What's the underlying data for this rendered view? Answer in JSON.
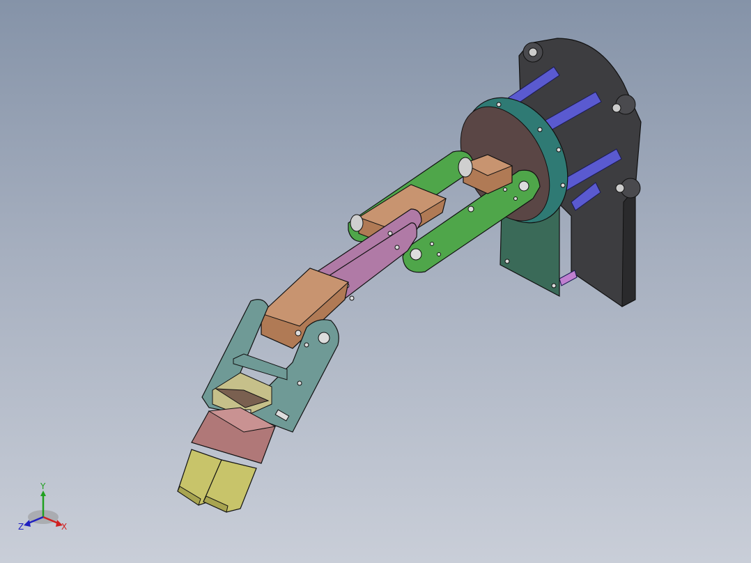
{
  "viewport": {
    "background_top": "#8593a8",
    "background_bottom": "#c9ced8"
  },
  "model": {
    "parts": [
      {
        "name": "base-plate",
        "color": "#3d3d40"
      },
      {
        "name": "standoff-rods",
        "color": "#5a5ad0"
      },
      {
        "name": "turntable-ring",
        "color": "#2f7a74"
      },
      {
        "name": "turntable-disc",
        "color": "#5a4645"
      },
      {
        "name": "mount-bracket",
        "color": "#3a6a58"
      },
      {
        "name": "upper-arm-bracket",
        "color": "#4fa64a"
      },
      {
        "name": "forearm-bracket",
        "color": "#b07aa6"
      },
      {
        "name": "wrist-bracket",
        "color": "#6f9a96"
      },
      {
        "name": "servo-housing",
        "color": "#b07a55"
      },
      {
        "name": "gripper-head",
        "color": "#b07878"
      },
      {
        "name": "gripper-fingers",
        "color": "#c8c46a"
      }
    ]
  },
  "triad": {
    "x_label": "X",
    "y_label": "Y",
    "z_label": "Z",
    "x_color": "#d02020",
    "y_color": "#20a020",
    "z_color": "#2020c0"
  }
}
